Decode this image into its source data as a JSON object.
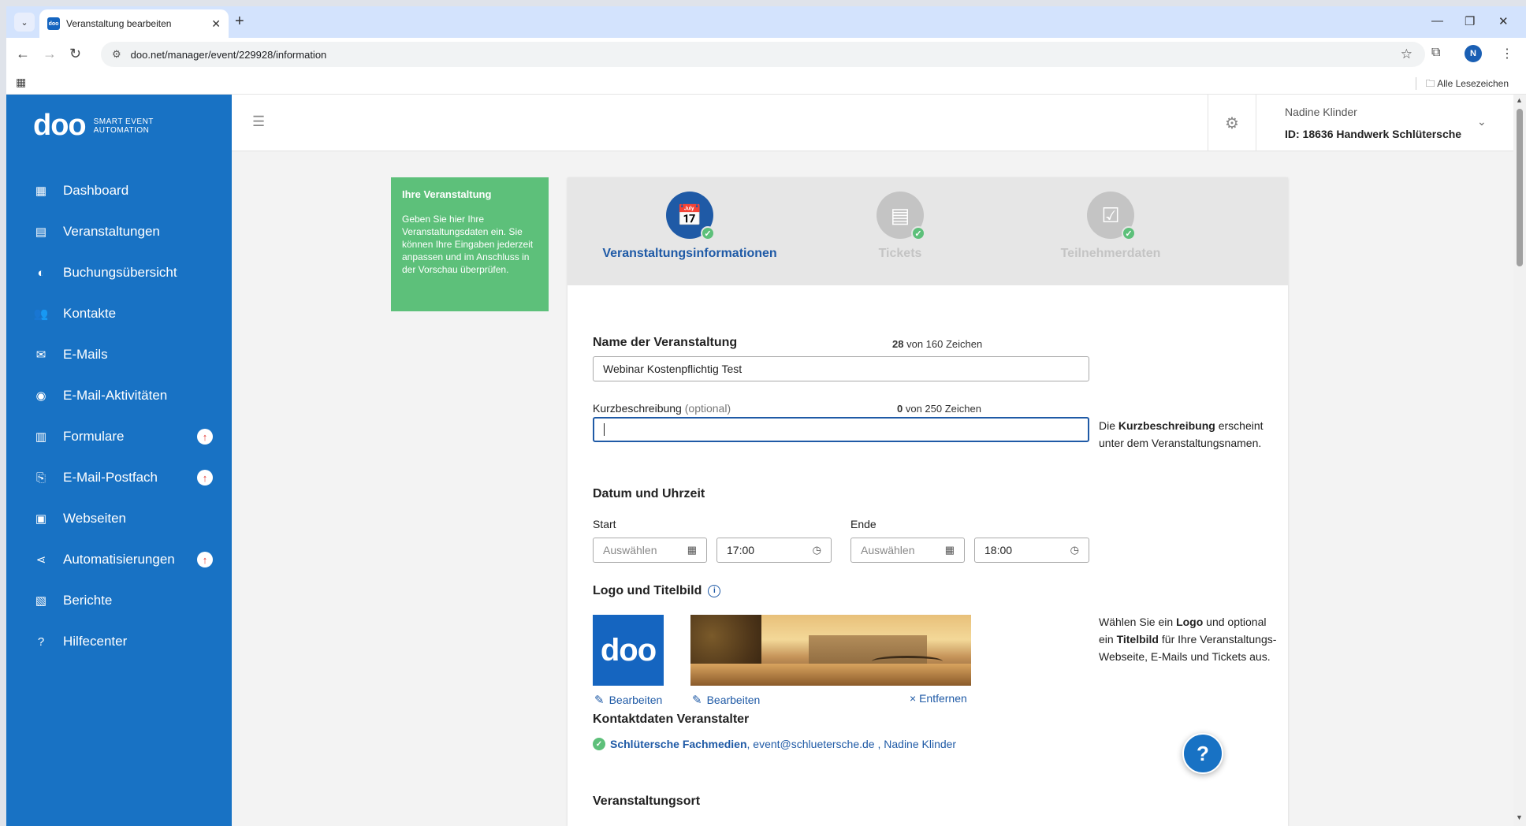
{
  "browser": {
    "tab_title": "Veranstaltung bearbeiten",
    "favicon_text": "doo",
    "url": "doo.net/manager/event/229928/information",
    "avatar_letter": "N",
    "bookmarks_label": "Alle Lesezeichen"
  },
  "sidebar": {
    "logo_word": "doo",
    "logo_tag_line1": "SMART EVENT",
    "logo_tag_line2": "AUTOMATION",
    "items": [
      {
        "label": "Dashboard",
        "icon": "dashboard-icon",
        "badge": ""
      },
      {
        "label": "Veranstaltungen",
        "icon": "calendar-icon",
        "badge": ""
      },
      {
        "label": "Buchungsübersicht",
        "icon": "booking-icon",
        "badge": ""
      },
      {
        "label": "Kontakte",
        "icon": "contacts-icon",
        "badge": ""
      },
      {
        "label": "E-Mails",
        "icon": "mail-icon",
        "badge": ""
      },
      {
        "label": "E-Mail-Aktivitäten",
        "icon": "activity-icon",
        "badge": ""
      },
      {
        "label": "Formulare",
        "icon": "form-icon",
        "badge": "↑"
      },
      {
        "label": "E-Mail-Postfach",
        "icon": "inbox-icon",
        "badge": "↑"
      },
      {
        "label": "Webseiten",
        "icon": "website-icon",
        "badge": ""
      },
      {
        "label": "Automatisierungen",
        "icon": "automation-icon",
        "badge": "↑"
      },
      {
        "label": "Berichte",
        "icon": "report-icon",
        "badge": ""
      },
      {
        "label": "Hilfecenter",
        "icon": "help-icon",
        "badge": ""
      }
    ]
  },
  "header": {
    "user_name": "Nadine Klinder",
    "user_id": "ID: 18636  Handwerk Schlütersche"
  },
  "infobox": {
    "title": "Ihre Veranstaltung",
    "text": "Geben Sie hier Ihre Veranstaltungsdaten ein. Sie können Ihre Eingaben jederzeit anpassen und im Anschluss in der Vorschau überprüfen."
  },
  "steps": [
    {
      "label": "Veranstaltungsinformationen",
      "active": true
    },
    {
      "label": "Tickets",
      "active": false
    },
    {
      "label": "Teilnehmerdaten",
      "active": false
    }
  ],
  "form": {
    "name_title": "Name der Veranstaltung",
    "name_count": "28",
    "name_count_suffix": "von 160 Zeichen",
    "name_value": "Webinar Kostenpflichtig Test",
    "short_label": "Kurzbeschreibung",
    "short_optional": "(optional)",
    "short_count": "0",
    "short_count_suffix": "von 250 Zeichen",
    "short_value": "",
    "short_hint_pre": "Die",
    "short_hint_bold": "Kurzbeschreibung",
    "short_hint_post": "erscheint unter dem Veranstaltungsnamen.",
    "date_title": "Datum und Uhrzeit",
    "start_label": "Start",
    "end_label": "Ende",
    "start_date_placeholder": "Auswählen",
    "start_time": "17:00",
    "end_date_placeholder": "Auswählen",
    "end_time": "18:00",
    "logo_title": "Logo und Titelbild",
    "logo_tile_text": "doo",
    "edit_label": "Bearbeiten",
    "remove_label": "× Entfernen",
    "logo_hint_1": "Wählen Sie ein",
    "logo_hint_logo": "Logo",
    "logo_hint_2": "und optional ein",
    "logo_hint_title": "Titelbild",
    "logo_hint_3": "für Ihre Veranstaltungs-Webseite, E-Mails und Tickets aus.",
    "contact_title": "Kontaktdaten Veranstalter",
    "contact_org": "Schlütersche Fachmedien",
    "contact_rest": ", event@schluetersche.de , Nadine Klinder",
    "venue_title": "Veranstaltungsort"
  },
  "help_button": "?"
}
